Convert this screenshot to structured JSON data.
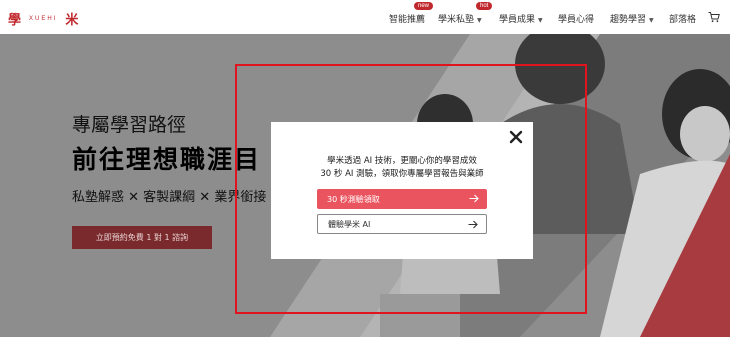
{
  "header": {
    "logo_left": "學",
    "logo_text": "XUEHI",
    "logo_right": "米",
    "nav": [
      {
        "label": "智能推薦",
        "badge": "new",
        "caret": false
      },
      {
        "label": "學米私塾",
        "badge": "hot",
        "caret": true
      },
      {
        "label": "學員成果",
        "badge": null,
        "caret": true
      },
      {
        "label": "學員心得",
        "badge": null,
        "caret": false
      },
      {
        "label": "趨勢學習",
        "badge": null,
        "caret": true
      },
      {
        "label": "部落格",
        "badge": null,
        "caret": false
      }
    ],
    "cart_icon": "cart-icon"
  },
  "hero": {
    "subtitle": "專屬學習路徑",
    "title": "前往理想職涯目",
    "tagline": "私塾解惑 ✕ 客製課綱 ✕ 業界銜接",
    "cta": "立即預約免費 1 對 1 諮詢"
  },
  "modal": {
    "line1": "學米透過 AI 技術，更關心你的學習成效",
    "line2": "30 秒 AI 測驗，領取你專屬學習報告與業師",
    "primary_button": "30 秒測驗領取",
    "secondary_button": "體驗學米 AI",
    "close_icon": "close-icon",
    "arrow_icon": "arrow-right-icon"
  },
  "colors": {
    "brand_red": "#c0282d",
    "primary_button": "#ea545f",
    "highlight_frame": "#e0141e",
    "overlay": "#8d8d8d"
  }
}
